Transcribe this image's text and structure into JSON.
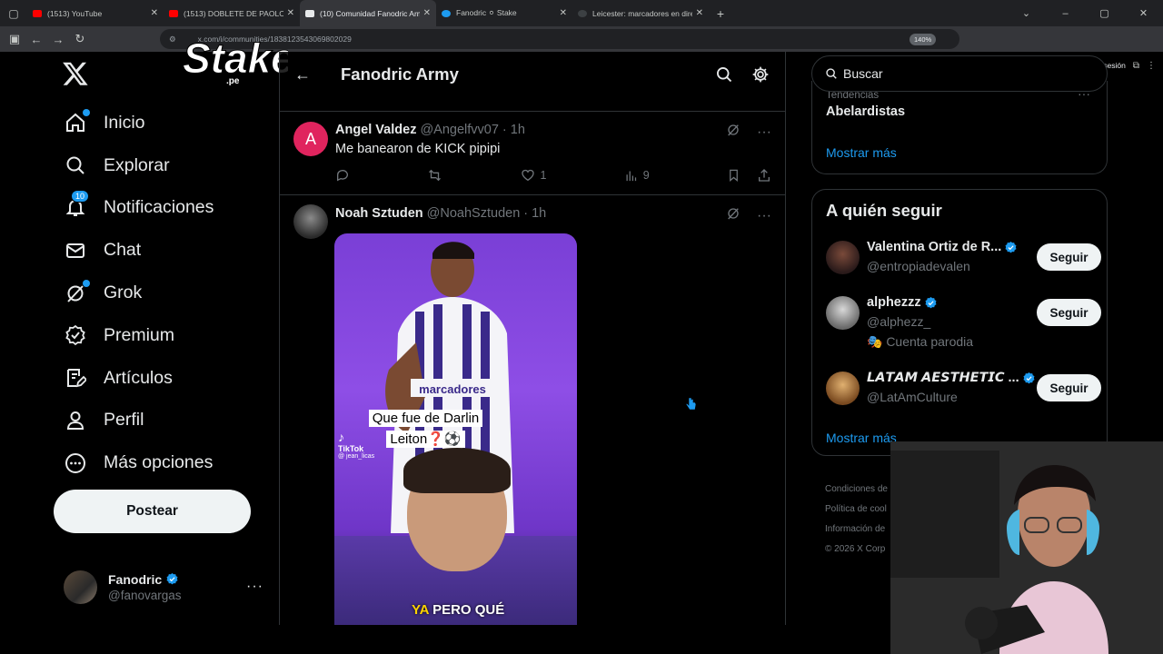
{
  "browser": {
    "tabs": [
      {
        "title": "(1513) YouTube",
        "color": "#ff0000",
        "active": false
      },
      {
        "title": "(1513) DOBLETE DE PAOLO Y TI",
        "color": "#ff0000",
        "active": false
      },
      {
        "title": "(10) Comunidad Fanodric Army",
        "color": "#e7e9ea",
        "active": true
      },
      {
        "title": "Fanodric ⚪ Stake",
        "color": "#1d9bf0",
        "active": false
      },
      {
        "title": "Leicester: marcadores en direct",
        "color": "#1f1f1f",
        "active": false
      }
    ],
    "url": "x.com/i/communities/1838123543069802029",
    "zoom": "140%",
    "signin": "Iniciar sesión"
  },
  "overlay": {
    "stake_text": "Stake",
    "stake_sub": ".pe"
  },
  "sidebar": {
    "items": [
      {
        "label": "Inicio",
        "icon": "home-icon"
      },
      {
        "label": "Explorar",
        "icon": "search-icon"
      },
      {
        "label": "Notificaciones",
        "icon": "bell-icon",
        "badge": "10"
      },
      {
        "label": "Chat",
        "icon": "mail-icon"
      },
      {
        "label": "Grok",
        "icon": "grok-icon"
      },
      {
        "label": "Premium",
        "icon": "premium-icon"
      },
      {
        "label": "Artículos",
        "icon": "articles-icon"
      },
      {
        "label": "Perfil",
        "icon": "profile-icon"
      },
      {
        "label": "Más opciones",
        "icon": "more-options-icon"
      }
    ],
    "post_label": "Postear",
    "account": {
      "name": "Fanodric",
      "handle": "@fanovargas"
    }
  },
  "main": {
    "title": "Fanodric Army",
    "posts": [
      {
        "avatar_letter": "A",
        "avatar_color": "#e0245e",
        "name": "Angel Valdez",
        "handle": "@Angelfvv07",
        "time": "· 1h",
        "text": "Me banearon de KICK pipipi",
        "likes": "1",
        "views": "9"
      },
      {
        "name": "Noah Sztuden",
        "handle": "@NoahSztuden",
        "time": "· 1h",
        "media": {
          "caption_line1": "Que fue de Darlin",
          "caption_line2": "Leiton❓⚽",
          "tiktok": "TikTok",
          "tiktok_user": "@ jean_licas",
          "jersey": "marcadores",
          "subtitle_a": "YA",
          "subtitle_b": " PERO QUÉ"
        }
      }
    ]
  },
  "right": {
    "search_placeholder": "Buscar",
    "trend_category": "Tendencias",
    "trend": "Abelardistas",
    "show_more": "Mostrar más",
    "follow_title": "A quién seguir",
    "follow": [
      {
        "name": "Valentina Ortiz de R...",
        "handle": "@entropiadevalen",
        "extra": ""
      },
      {
        "name": "alphezzz",
        "handle": "@alphezz_",
        "extra": "🎭 Cuenta parodia"
      },
      {
        "name": "𝙇𝘼𝙏𝘼𝙈 𝘼𝙀𝙎𝙏𝙃𝙀𝙏𝙄𝘾 ...",
        "handle": "@LatAmCulture",
        "extra": ""
      }
    ],
    "follow_button": "Seguir",
    "footer": [
      "Condiciones de",
      "Política de cool",
      "Información de",
      "© 2026 X Corp"
    ]
  },
  "colors": {
    "accent": "#1d9bf0",
    "background": "#000000",
    "border": "#2f3336",
    "muted": "#71767b"
  }
}
